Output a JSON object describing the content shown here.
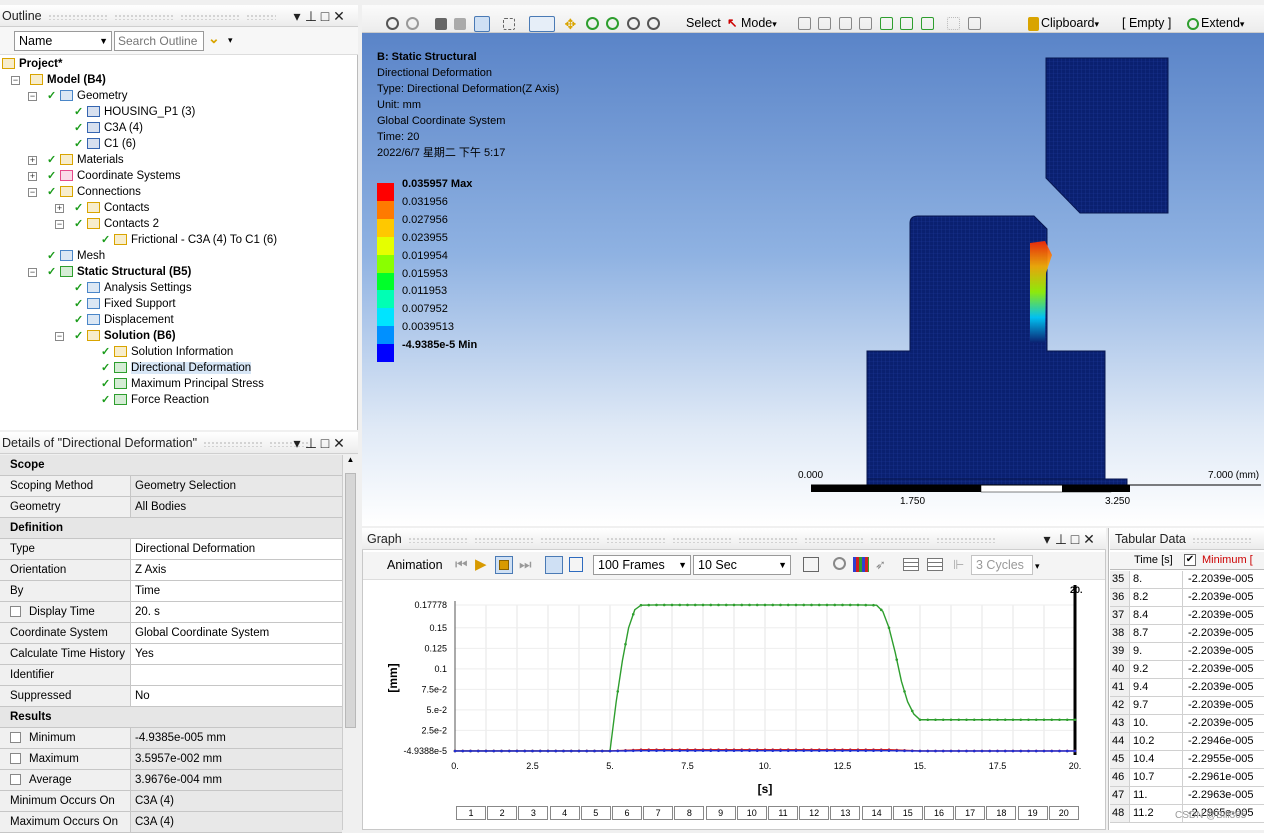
{
  "outline": {
    "title": "Outline",
    "name_dropdown": "Name",
    "search_placeholder": "Search Outline",
    "tree": [
      {
        "label": "Project*"
      },
      {
        "label": "Model (B4)"
      },
      {
        "label": "Geometry"
      },
      {
        "label": "HOUSING_P1 (3)"
      },
      {
        "label": "C3A (4)"
      },
      {
        "label": "C1 (6)"
      },
      {
        "label": "Materials"
      },
      {
        "label": "Coordinate Systems"
      },
      {
        "label": "Connections"
      },
      {
        "label": "Contacts"
      },
      {
        "label": "Contacts 2"
      },
      {
        "label": "Frictional - C3A (4) To C1 (6)"
      },
      {
        "label": "Mesh"
      },
      {
        "label": "Static Structural (B5)"
      },
      {
        "label": "Analysis Settings"
      },
      {
        "label": "Fixed Support"
      },
      {
        "label": "Displacement"
      },
      {
        "label": "Solution (B6)"
      },
      {
        "label": "Solution Information"
      },
      {
        "label": "Directional Deformation"
      },
      {
        "label": "Maximum Principal Stress"
      },
      {
        "label": "Force Reaction"
      }
    ]
  },
  "details": {
    "title": "Details of \"Directional Deformation\"",
    "sections": {
      "scope": "Scope",
      "definition": "Definition",
      "results": "Results"
    },
    "rows": {
      "scoping_method": {
        "k": "Scoping Method",
        "v": "Geometry Selection"
      },
      "geometry": {
        "k": "Geometry",
        "v": "All Bodies"
      },
      "type": {
        "k": "Type",
        "v": "Directional Deformation"
      },
      "orientation": {
        "k": "Orientation",
        "v": "Z Axis"
      },
      "by": {
        "k": "By",
        "v": "Time"
      },
      "display_time": {
        "k": "Display Time",
        "v": "20. s"
      },
      "coord": {
        "k": "Coordinate System",
        "v": "Global Coordinate System"
      },
      "calc_hist": {
        "k": "Calculate Time History",
        "v": "Yes"
      },
      "identifier": {
        "k": "Identifier",
        "v": ""
      },
      "suppressed": {
        "k": "Suppressed",
        "v": "No"
      },
      "minimum": {
        "k": "Minimum",
        "v": "-4.9385e-005 mm"
      },
      "maximum": {
        "k": "Maximum",
        "v": "3.5957e-002 mm"
      },
      "average": {
        "k": "Average",
        "v": "3.9676e-004 mm"
      },
      "min_on": {
        "k": "Minimum Occurs On",
        "v": "C3A (4)"
      },
      "max_on": {
        "k": "Maximum Occurs On",
        "v": "C3A (4)"
      }
    }
  },
  "toolbar": {
    "select": "Select",
    "mode": "Mode",
    "clipboard": "Clipboard",
    "empty": "[ Empty ]",
    "extend": "Extend"
  },
  "viewport": {
    "info": [
      "B: Static Structural",
      "Directional Deformation",
      "Type: Directional Deformation(Z Axis)",
      "Unit: mm",
      "Global Coordinate System",
      "Time: 20",
      "2022/6/7 星期二 下午 5:17"
    ],
    "legend": {
      "max_label": "0.035957 Max",
      "values": [
        "0.031956",
        "0.027956",
        "0.023955",
        "0.019954",
        "0.015953",
        "0.011953",
        "0.007952",
        "0.0039513"
      ],
      "min_label": "-4.9385e-5 Min",
      "colors": [
        "#ff0000",
        "#ff7a00",
        "#ffc800",
        "#e5ff00",
        "#8aff00",
        "#00ff2a",
        "#00ffb4",
        "#00e4ff",
        "#0090ff",
        "#0000ff"
      ]
    },
    "scale": {
      "left": "0.000",
      "mid": "1.750",
      "right_mid": "3.250",
      "right": "7.000 (mm)"
    }
  },
  "graph": {
    "title": "Graph",
    "animation_label": "Animation",
    "frames": "100 Frames",
    "duration": "10 Sec",
    "cycles": "3 Cycles",
    "ylabel": "[mm]",
    "xlabel": "[s]",
    "top_right_label": "20.",
    "frame_numbers": [
      "1",
      "2",
      "3",
      "4",
      "5",
      "6",
      "7",
      "8",
      "9",
      "10",
      "11",
      "12",
      "13",
      "14",
      "15",
      "16",
      "17",
      "18",
      "19",
      "20"
    ]
  },
  "chart_data": {
    "type": "line",
    "xlabel": "[s]",
    "ylabel": "[mm]",
    "xlim": [
      0,
      20
    ],
    "ylim": [
      -4.9388e-05,
      0.17778
    ],
    "yticks": [
      "0.17778",
      "0.15",
      "0.125",
      "0.1",
      "7.5e-2",
      "5.e-2",
      "2.5e-2",
      "-4.9388e-5"
    ],
    "ytick_values": [
      0.17778,
      0.15,
      0.125,
      0.1,
      0.075,
      0.05,
      0.025,
      -4.9388e-05
    ],
    "xticks": [
      "0.",
      "2.5",
      "5.",
      "7.5",
      "10.",
      "12.5",
      "15.",
      "17.5",
      "20."
    ],
    "xtick_values": [
      0,
      2.5,
      5,
      7.5,
      10,
      12.5,
      15,
      17.5,
      20
    ],
    "series": [
      {
        "color": "#2e9e2e",
        "x": [
          0,
          5,
          5.2,
          5.4,
          5.6,
          5.8,
          6,
          6.5,
          7,
          8,
          9,
          10,
          11,
          12,
          13,
          13.6,
          13.8,
          14,
          14.2,
          14.4,
          14.6,
          14.8,
          15,
          16,
          17,
          18,
          19,
          20
        ],
        "y": [
          0,
          0,
          0.06,
          0.11,
          0.15,
          0.172,
          0.1775,
          0.1778,
          0.1778,
          0.1778,
          0.1778,
          0.1778,
          0.1778,
          0.1778,
          0.1778,
          0.1775,
          0.17,
          0.15,
          0.12,
          0.085,
          0.06,
          0.045,
          0.038,
          0.038,
          0.038,
          0.038,
          0.038,
          0.038
        ]
      },
      {
        "color": "#d21f1f",
        "x": [
          0,
          5,
          6,
          7,
          8,
          9,
          10,
          11,
          12,
          13,
          14,
          15,
          16,
          17,
          18,
          19,
          20
        ],
        "y": [
          0,
          0,
          0.0015,
          0.0015,
          0.0015,
          0.0015,
          0.0015,
          0.0015,
          0.0015,
          0.0015,
          0.0015,
          0,
          0,
          0,
          0,
          0,
          0
        ]
      },
      {
        "color": "#1f2fd2",
        "x": [
          0,
          2,
          4,
          5,
          6,
          8,
          10,
          12,
          14,
          15,
          16,
          18,
          20
        ],
        "y": [
          -5e-05,
          -5e-05,
          -5e-05,
          -5e-05,
          0.0003,
          0.0003,
          0.0003,
          0.0003,
          0.0003,
          -5e-05,
          -5e-05,
          -5e-05,
          -5e-05
        ]
      }
    ]
  },
  "tabular": {
    "title": "Tabular Data",
    "col_time": "Time [s]",
    "col_min": "Minimum [",
    "rows": [
      {
        "n": "35",
        "t": "8.",
        "v": "-2.2039e-005"
      },
      {
        "n": "36",
        "t": "8.2",
        "v": "-2.2039e-005"
      },
      {
        "n": "37",
        "t": "8.4",
        "v": "-2.2039e-005"
      },
      {
        "n": "38",
        "t": "8.7",
        "v": "-2.2039e-005"
      },
      {
        "n": "39",
        "t": "9.",
        "v": "-2.2039e-005"
      },
      {
        "n": "40",
        "t": "9.2",
        "v": "-2.2039e-005"
      },
      {
        "n": "41",
        "t": "9.4",
        "v": "-2.2039e-005"
      },
      {
        "n": "42",
        "t": "9.7",
        "v": "-2.2039e-005"
      },
      {
        "n": "43",
        "t": "10.",
        "v": "-2.2039e-005"
      },
      {
        "n": "44",
        "t": "10.2",
        "v": "-2.2946e-005"
      },
      {
        "n": "45",
        "t": "10.4",
        "v": "-2.2955e-005"
      },
      {
        "n": "46",
        "t": "10.7",
        "v": "-2.2961e-005"
      },
      {
        "n": "47",
        "t": "11.",
        "v": "-2.2963e-005"
      },
      {
        "n": "48",
        "t": "11.2",
        "v": "-2.2965e-005"
      }
    ],
    "watermark": "CSDN @Bill365"
  }
}
